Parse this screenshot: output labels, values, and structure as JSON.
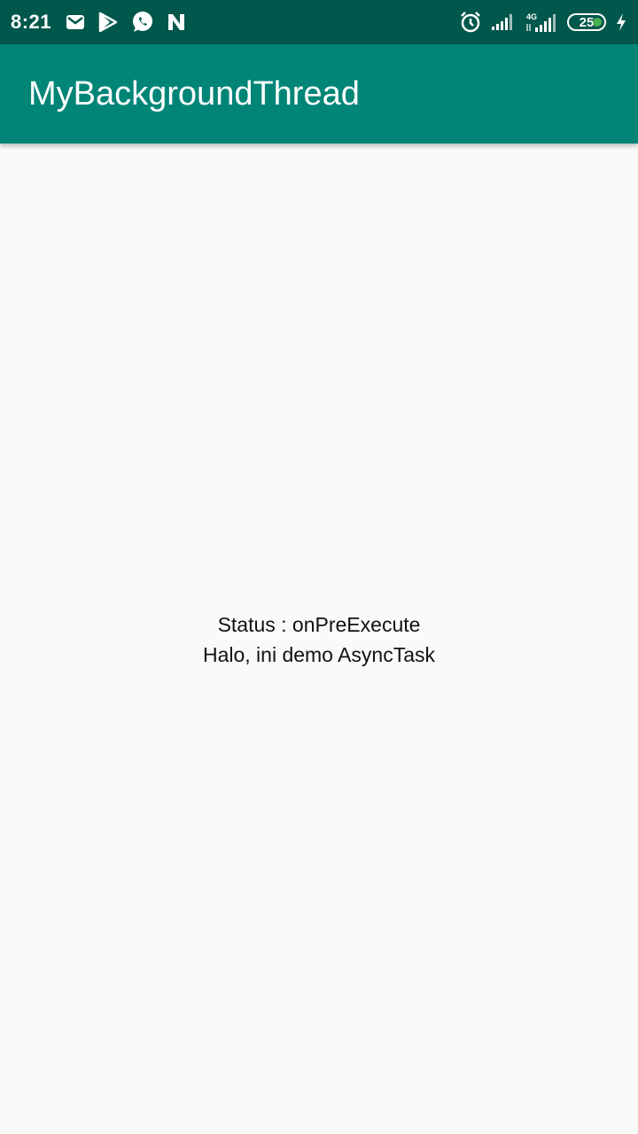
{
  "status_bar": {
    "time": "8:21",
    "left_icons": [
      "gmail-icon",
      "play-store-icon",
      "whatsapp-icon",
      "n-app-icon"
    ],
    "right_icons": [
      "alarm-icon",
      "signal-icon",
      "signal-4g-icon"
    ],
    "network_label": "4G",
    "battery_level": "25",
    "charging": true
  },
  "app_bar": {
    "title": "MyBackgroundThread"
  },
  "main": {
    "status_text": "Status : onPreExecute",
    "demo_text": "Halo, ini demo AsyncTask"
  },
  "colors": {
    "status_bar": "#00574b",
    "app_bar": "#008577",
    "background": "#fafafa"
  }
}
